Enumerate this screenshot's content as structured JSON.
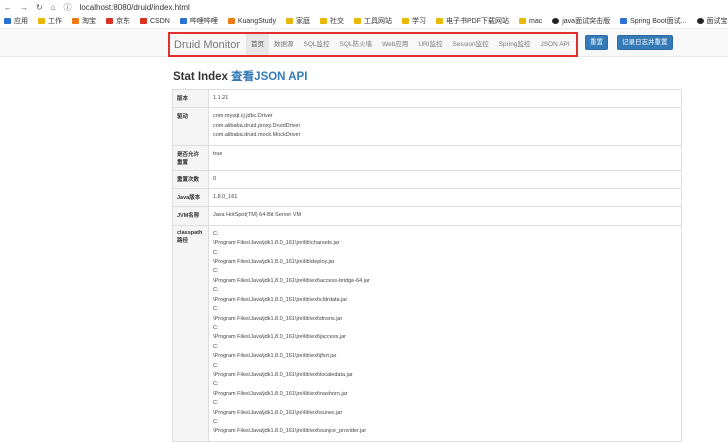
{
  "browser": {
    "url": "localhost:8080/druid/index.html",
    "bookmarks": [
      {
        "label": "应用",
        "icon": "apps-icon",
        "color": "blu"
      },
      {
        "label": "工作",
        "icon": "folder-icon",
        "color": ""
      },
      {
        "label": "淘宝",
        "icon": "taobao-icon",
        "color": "ora"
      },
      {
        "label": "京东",
        "icon": "jd-icon",
        "color": "red"
      },
      {
        "label": "CSDN",
        "icon": "csdn-icon",
        "color": "red"
      },
      {
        "label": "哔哩哔哩",
        "icon": "bilibili-icon",
        "color": "blu"
      },
      {
        "label": "KuangStudy",
        "icon": "kuangstudy-icon",
        "color": "ora"
      },
      {
        "label": "家庭",
        "icon": "folder-icon",
        "color": ""
      },
      {
        "label": "社交",
        "icon": "folder-icon",
        "color": ""
      },
      {
        "label": "工具网站",
        "icon": "folder-icon",
        "color": ""
      },
      {
        "label": "学习",
        "icon": "folder-icon",
        "color": ""
      },
      {
        "label": "电子书PDF下载网站",
        "icon": "folder-icon",
        "color": ""
      },
      {
        "label": "mac",
        "icon": "folder-icon",
        "color": ""
      },
      {
        "label": "java面试突击版",
        "icon": "java-icon",
        "color": "blk"
      },
      {
        "label": "Spring Boot面试...",
        "icon": "spring-icon",
        "color": "blu"
      },
      {
        "label": "面试宝典2",
        "icon": "github-icon",
        "color": "blk"
      }
    ]
  },
  "nav": {
    "brand": "Druid Monitor",
    "items": [
      "首页",
      "数据源",
      "SQL监控",
      "SQL防火墙",
      "Web应用",
      "URI监控",
      "Session监控",
      "Spring监控",
      "JSON API"
    ],
    "active_index": 0,
    "reset_label": "重置",
    "reset_log_label": "记录日志并重置"
  },
  "page": {
    "title_prefix": "Stat Index",
    "title_link": "查看JSON API"
  },
  "rows": [
    {
      "key": "版本",
      "lines": [
        "1.1.21"
      ]
    },
    {
      "key": "驱动",
      "lines": [
        "com.mysql.cj.jdbc.Driver",
        "com.alibaba.druid.proxy.DruidDriver",
        "com.alibaba.druid.mock.MockDriver"
      ]
    },
    {
      "key": "是否允许重置",
      "lines": [
        "true"
      ]
    },
    {
      "key": "重置次数",
      "lines": [
        "0"
      ]
    },
    {
      "key": "Java版本",
      "lines": [
        "1.8.0_161"
      ]
    },
    {
      "key": "JVM名称",
      "lines": [
        "Java HotSpot(TM) 64-Bit Server VM"
      ]
    },
    {
      "key": "classpath路径",
      "lines": [
        "C:",
        "\\Program Files\\Java\\jdk1.8.0_161\\jre\\lib\\charsets.jar",
        "C:",
        "\\Program Files\\Java\\jdk1.8.0_161\\jre\\lib\\deploy.jar",
        "C:",
        "\\Program Files\\Java\\jdk1.8.0_161\\jre\\lib\\ext\\access-bridge-64.jar",
        "C:",
        "\\Program Files\\Java\\jdk1.8.0_161\\jre\\lib\\ext\\cldrdata.jar",
        "C:",
        "\\Program Files\\Java\\jdk1.8.0_161\\jre\\lib\\ext\\dnsns.jar",
        "C:",
        "\\Program Files\\Java\\jdk1.8.0_161\\jre\\lib\\ext\\jaccess.jar",
        "C:",
        "\\Program Files\\Java\\jdk1.8.0_161\\jre\\lib\\ext\\jfxrt.jar",
        "C:",
        "\\Program Files\\Java\\jdk1.8.0_161\\jre\\lib\\ext\\localedata.jar",
        "C:",
        "\\Program Files\\Java\\jdk1.8.0_161\\jre\\lib\\ext\\nashorn.jar",
        "C:",
        "\\Program Files\\Java\\jdk1.8.0_161\\jre\\lib\\ext\\sunec.jar",
        "C:",
        "\\Program Files\\Java\\jdk1.8.0_161\\jre\\lib\\ext\\sunjce_provider.jar"
      ]
    }
  ]
}
